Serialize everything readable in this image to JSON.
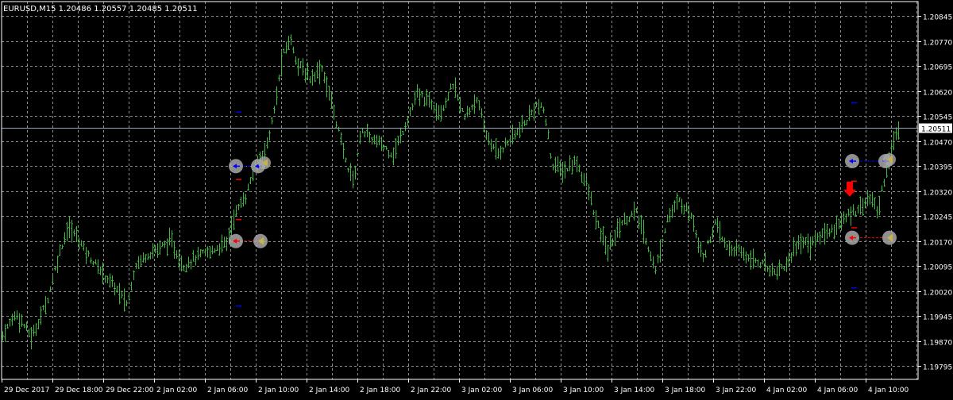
{
  "window": {
    "symbol_line": "EURUSD,M15  1.20486 1.20557 1.20485 1.20511"
  },
  "colors": {
    "background": "#000000",
    "bars": "#3cb83c",
    "grid": "#8c8c8c",
    "axis": "#ffffff",
    "price_line": "#9aa8b8",
    "blue_marker": "#0000ff",
    "red_marker": "#ff0000",
    "sell_arrow": "#ff0000"
  },
  "chart_data": {
    "type": "ohlc_bar",
    "symbol": "EURUSD",
    "timeframe": "M15",
    "ohlc": {
      "open": 1.20486,
      "high": 1.20557,
      "low": 1.20485,
      "close": 1.20511
    },
    "current_price_label": "1.20511",
    "current_price": 1.20511,
    "ylim": [
      1.19755,
      1.20889
    ],
    "y_ticks": [
      "1.20845",
      "1.20770",
      "1.20695",
      "1.20620",
      "1.20545",
      "1.20470",
      "1.20395",
      "1.20320",
      "1.20245",
      "1.20170",
      "1.20095",
      "1.20020",
      "1.19945",
      "1.19870",
      "1.19795"
    ],
    "x_ticks": [
      "29 Dec 2017",
      "29 Dec 18:00",
      "29 Dec 22:00",
      "2 Jan 02:00",
      "2 Jan 06:00",
      "2 Jan 10:00",
      "2 Jan 14:00",
      "2 Jan 18:00",
      "2 Jan 22:00",
      "3 Jan 02:00",
      "3 Jan 06:00",
      "3 Jan 10:00",
      "3 Jan 14:00",
      "3 Jan 18:00",
      "3 Jan 22:00",
      "4 Jan 02:00",
      "4 Jan 06:00",
      "4 Jan 10:00"
    ],
    "price_path": [
      [
        0,
        1.19875
      ],
      [
        20,
        1.19955
      ],
      [
        40,
        1.1988
      ],
      [
        60,
        1.2
      ],
      [
        75,
        1.2014
      ],
      [
        85,
        1.2021
      ],
      [
        95,
        1.2019
      ],
      [
        110,
        1.2013
      ],
      [
        125,
        1.20085
      ],
      [
        145,
        1.2003
      ],
      [
        160,
        1.1998
      ],
      [
        170,
        1.201
      ],
      [
        185,
        1.2013
      ],
      [
        200,
        1.2015
      ],
      [
        215,
        1.2017
      ],
      [
        230,
        1.20095
      ],
      [
        245,
        1.2012
      ],
      [
        265,
        1.2014
      ],
      [
        285,
        1.20165
      ],
      [
        295,
        1.2025
      ],
      [
        310,
        1.2031
      ],
      [
        320,
        1.2039
      ],
      [
        335,
        1.2045
      ],
      [
        345,
        1.2056
      ],
      [
        355,
        1.2072
      ],
      [
        365,
        1.2078
      ],
      [
        375,
        1.207
      ],
      [
        390,
        1.2066
      ],
      [
        405,
        1.2069
      ],
      [
        420,
        1.2056
      ],
      [
        435,
        1.2041
      ],
      [
        445,
        1.2035
      ],
      [
        455,
        1.2051
      ],
      [
        465,
        1.2048
      ],
      [
        480,
        1.2046
      ],
      [
        495,
        1.2043
      ],
      [
        510,
        1.2052
      ],
      [
        525,
        1.2061
      ],
      [
        540,
        1.2059
      ],
      [
        555,
        1.2056
      ],
      [
        570,
        1.2064
      ],
      [
        585,
        1.2054
      ],
      [
        600,
        1.206
      ],
      [
        610,
        1.205
      ],
      [
        625,
        1.2043
      ],
      [
        640,
        1.2047
      ],
      [
        660,
        1.2052
      ],
      [
        675,
        1.2058
      ],
      [
        685,
        1.2056
      ],
      [
        695,
        1.204
      ],
      [
        710,
        1.2038
      ],
      [
        725,
        1.2041
      ],
      [
        740,
        1.2033
      ],
      [
        750,
        1.2023
      ],
      [
        765,
        1.2014
      ],
      [
        780,
        1.2022
      ],
      [
        800,
        1.2026
      ],
      [
        815,
        1.2016
      ],
      [
        825,
        1.2008
      ],
      [
        840,
        1.2024
      ],
      [
        855,
        1.2029
      ],
      [
        870,
        1.2025
      ],
      [
        885,
        1.2012
      ],
      [
        900,
        1.2022
      ],
      [
        915,
        1.2015
      ],
      [
        930,
        1.2014
      ],
      [
        945,
        1.2012
      ],
      [
        960,
        1.201
      ],
      [
        975,
        1.2008
      ],
      [
        990,
        1.201
      ],
      [
        1005,
        1.2017
      ],
      [
        1020,
        1.2016
      ],
      [
        1035,
        1.2019
      ],
      [
        1050,
        1.2021
      ],
      [
        1065,
        1.2024
      ],
      [
        1080,
        1.2027
      ],
      [
        1095,
        1.203
      ],
      [
        1105,
        1.2026
      ],
      [
        1115,
        1.2038
      ],
      [
        1125,
        1.2047
      ],
      [
        1132,
        1.20511
      ]
    ],
    "markers": [
      {
        "kind": "blue_dash",
        "t": 300,
        "price": 1.20557
      },
      {
        "kind": "red_dash",
        "t": 300,
        "price": 1.20355
      },
      {
        "kind": "red_dash",
        "t": 300,
        "price": 1.20235
      },
      {
        "kind": "blue_dash",
        "t": 300,
        "price": 1.19975
      },
      {
        "kind": "red_dash",
        "t": 1075,
        "price": 1.2035
      },
      {
        "kind": "red_dash",
        "t": 1075,
        "price": 1.2021
      },
      {
        "kind": "blue_dash",
        "t": 1075,
        "price": 1.20585
      },
      {
        "kind": "blue_dash",
        "t": 1075,
        "price": 1.2003
      },
      {
        "kind": "sell_arrow",
        "t": 1070,
        "price": 1.2032
      }
    ],
    "trades": [
      {
        "side": "buy",
        "open_t": 297,
        "open_price": 1.20395,
        "close_t": 325,
        "close_price": 1.20395,
        "exit_flag_t": 333,
        "exit_flag_price": 1.20405
      },
      {
        "side": "sell",
        "open_t": 297,
        "open_price": 1.2017,
        "close_t": 328,
        "close_price": 1.2017
      },
      {
        "side": "buy",
        "open_t": 1073,
        "open_price": 1.2041,
        "close_t": 1115,
        "close_price": 1.2041,
        "exit_flag_t": 1120,
        "exit_flag_price": 1.20415
      },
      {
        "side": "sell",
        "open_t": 1073,
        "open_price": 1.2018,
        "close_t": 1120,
        "close_price": 1.2018
      }
    ]
  }
}
